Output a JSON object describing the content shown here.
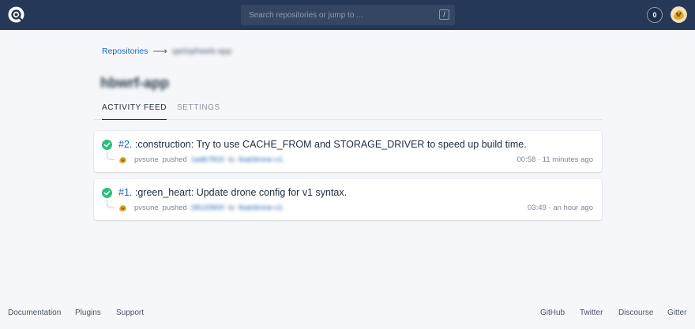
{
  "header": {
    "search_placeholder": "Search repositories or jump to ...",
    "slash_hint": "/",
    "build_count": "0"
  },
  "breadcrumb": {
    "root_label": "Repositories",
    "separator": "⟶",
    "repo_path": "qarlophweb-app"
  },
  "repo": {
    "title": "hbwrf-app"
  },
  "tabs": [
    {
      "label": "ACTIVITY FEED"
    },
    {
      "label": "SETTINGS"
    }
  ],
  "builds": [
    {
      "number": "#2.",
      "message": ":construction: Try to use CACHE_FROM and STORAGE_DRIVER to speed up build time.",
      "author": "pvsune",
      "action": "pushed",
      "commit": "1adb7815",
      "to_word": "to",
      "branch": "feat/drone-v1",
      "duration": "00:58",
      "separator": "·",
      "ago": "11 minutes ago"
    },
    {
      "number": "#1.",
      "message": ":green_heart: Update drone config for v1 syntax.",
      "author": "pvsune",
      "action": "pushed",
      "commit": "28120600",
      "to_word": "to",
      "branch": "feat/drone-v1",
      "duration": "03:49",
      "separator": "·",
      "ago": "an hour ago"
    }
  ],
  "footer": {
    "left": [
      "Documentation",
      "Plugins",
      "Support"
    ],
    "right": [
      "GitHub",
      "Twitter",
      "Discourse",
      "Gitter"
    ]
  },
  "colors": {
    "topbar": "#253858",
    "accent": "#1c62b9",
    "success": "#2bbf7e"
  }
}
